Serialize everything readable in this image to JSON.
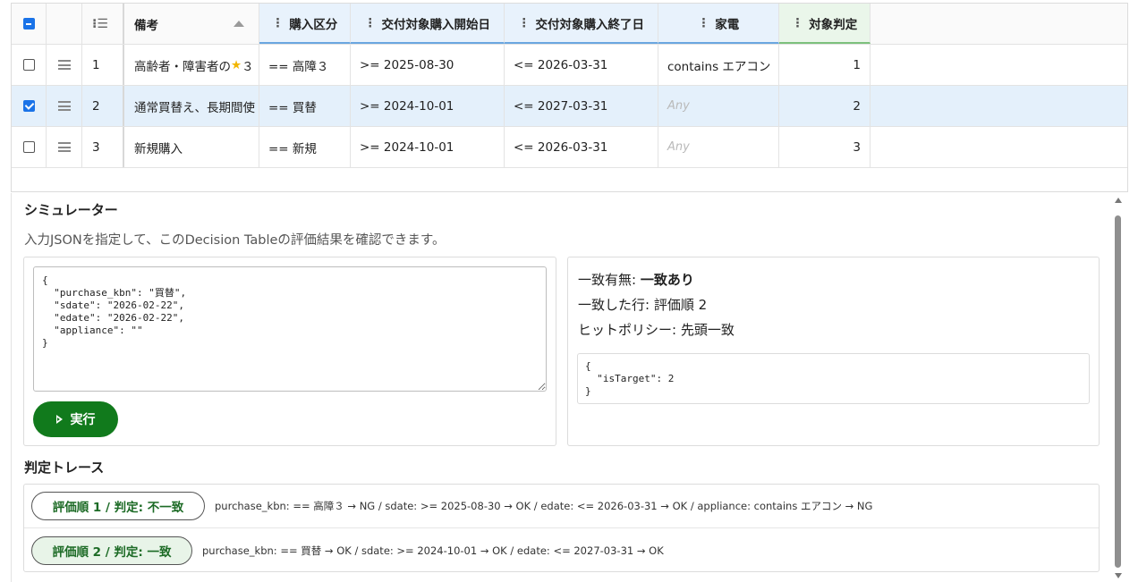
{
  "table": {
    "headers": {
      "note": "備考",
      "purchase_kbn": "購入区分",
      "sdate": "交付対象購入開始日",
      "edate": "交付対象購入終了日",
      "appliance": "家電",
      "result": "対象判定"
    },
    "rows": [
      {
        "checked": false,
        "num": "1",
        "note": "高齢者・障害者の",
        "note_suffix": "３",
        "purchase_kbn": "== 高障３",
        "sdate": ">= 2025-08-30",
        "edate": "<= 2026-03-31",
        "appliance": "contains エアコン",
        "result": "1"
      },
      {
        "checked": true,
        "num": "2",
        "note": "通常買替え、長期間使",
        "purchase_kbn": "== 買替",
        "sdate": ">= 2024-10-01",
        "edate": "<= 2027-03-31",
        "appliance": "Any",
        "result": "2"
      },
      {
        "checked": false,
        "num": "3",
        "note": "新規購入",
        "purchase_kbn": "== 新規",
        "sdate": ">= 2024-10-01",
        "edate": "<= 2026-03-31",
        "appliance": "Any",
        "result": "3"
      }
    ]
  },
  "simulator": {
    "title": "シミュレーター",
    "description": "入力JSONを指定して、このDecision Tableの評価結果を確認できます。",
    "input_json": "{\n  \"purchase_kbn\": \"買替\",\n  \"sdate\": \"2026-02-22\",\n  \"edate\": \"2026-02-22\",\n  \"appliance\": \"\"\n}",
    "run_label": "実行",
    "match_label": "一致有無: ",
    "match_value": "一致あり",
    "matched_row": "一致した行: 評価順 2",
    "hit_policy": "ヒットポリシー: 先頭一致",
    "output_json": "{\n  \"isTarget\": 2\n}"
  },
  "trace": {
    "title": "判定トレース",
    "items": [
      {
        "label": "評価順 1 / 判定: 不一致",
        "detail": "purchase_kbn: == 高障３ → NG / sdate: >= 2025-08-30 → OK / edate: <= 2026-03-31 → OK / appliance: contains エアコン → NG"
      },
      {
        "label": "評価順 2 / 判定: 一致",
        "detail": "purchase_kbn: == 買替 → OK / sdate: >= 2024-10-01 → OK / edate: <= 2027-03-31 → OK"
      }
    ]
  },
  "colors": {
    "accent": "#1a73e8",
    "run_button": "#117a1c",
    "selected_row": "#e4f0fb"
  }
}
